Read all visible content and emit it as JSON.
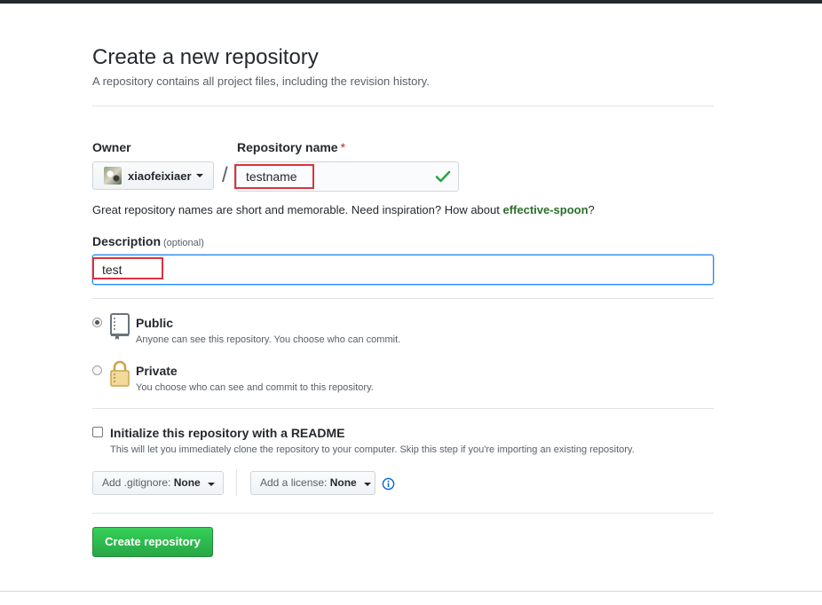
{
  "header": {
    "title": "Create a new repository",
    "subtitle": "A repository contains all project files, including the revision history."
  },
  "owner": {
    "label": "Owner",
    "value": "xiaofeixiaer"
  },
  "repository": {
    "label": "Repository name",
    "required_mark": "*",
    "value": "testname",
    "separator": "/"
  },
  "hint": {
    "text": "Great repository names are short and memorable. Need inspiration? How about ",
    "suggestion": "effective-spoon",
    "end": "?"
  },
  "description": {
    "label": "Description",
    "optional": "(optional)",
    "value": "test"
  },
  "visibility": {
    "public": {
      "title": "Public",
      "desc": "Anyone can see this repository. You choose who can commit.",
      "selected": true
    },
    "private": {
      "title": "Private",
      "desc": "You choose who can see and commit to this repository.",
      "selected": false
    }
  },
  "init": {
    "title": "Initialize this repository with a README",
    "desc": "This will let you immediately clone the repository to your computer. Skip this step if you're importing an existing repository.",
    "checked": false
  },
  "gitignore": {
    "prefix": "Add .gitignore:",
    "value": "None"
  },
  "license": {
    "prefix": "Add a license:",
    "value": "None"
  },
  "submit": {
    "label": "Create repository"
  },
  "colors": {
    "accent_green": "#28a745",
    "annotation_red": "#d9343f",
    "focus_blue": "#2188ff"
  },
  "icons": [
    "check-icon",
    "repo-book-icon",
    "lock-icon",
    "info-icon",
    "chevron-down-icon"
  ]
}
